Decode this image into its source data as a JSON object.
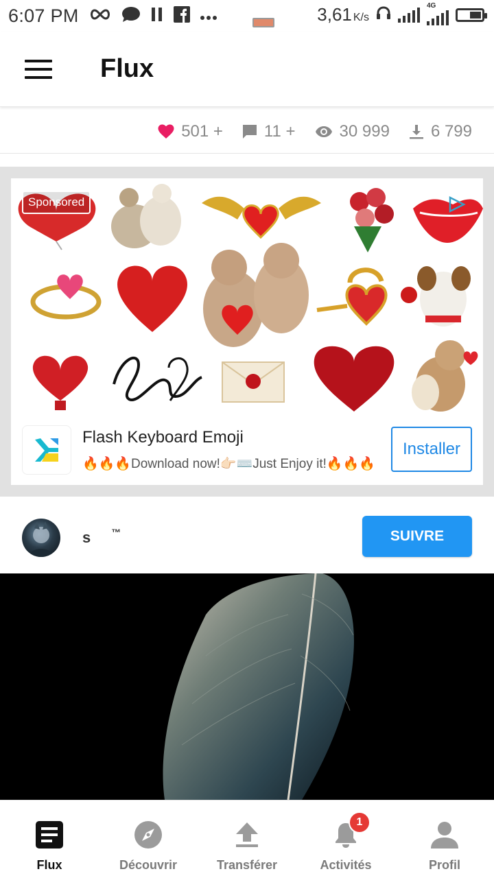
{
  "status_bar": {
    "time": "6:07 PM",
    "speed": "3,61",
    "speed_unit": "K/s",
    "network_type": "4G",
    "icons": [
      "infinity-icon",
      "chat-bubble-icon",
      "pause-icon",
      "facebook-icon",
      "more-dots-icon",
      "headset-icon",
      "signal-icon",
      "battery-icon"
    ]
  },
  "app_bar": {
    "title": "Flux",
    "menu_icon": "hamburger-menu-icon"
  },
  "stats": {
    "likes": "501 +",
    "comments": "11 +",
    "views": "30 999",
    "downloads": "6 799",
    "colors": {
      "heart": "#e91e63",
      "muted": "#8a8a8a"
    }
  },
  "ad": {
    "sponsored_label": "Sponsored",
    "title": "Flash Keyboard Emoji",
    "subtitle": "🔥🔥🔥Download now!👉🏻⌨️Just Enjoy it!🔥🔥🔥",
    "install_label": "Installer",
    "accent_color": "#1e88e5"
  },
  "post": {
    "username": "s",
    "username_suffix": "™",
    "follow_label": "SUIVRE",
    "follow_color": "#2196f3"
  },
  "bottom_nav": {
    "items": [
      {
        "label": "Flux",
        "icon": "feed-icon",
        "active": true
      },
      {
        "label": "Découvrir",
        "icon": "compass-icon",
        "active": false
      },
      {
        "label": "Transférer",
        "icon": "upload-icon",
        "active": false
      },
      {
        "label": "Activités",
        "icon": "bell-icon",
        "active": false,
        "badge": "1"
      },
      {
        "label": "Profil",
        "icon": "person-icon",
        "active": false
      }
    ]
  }
}
